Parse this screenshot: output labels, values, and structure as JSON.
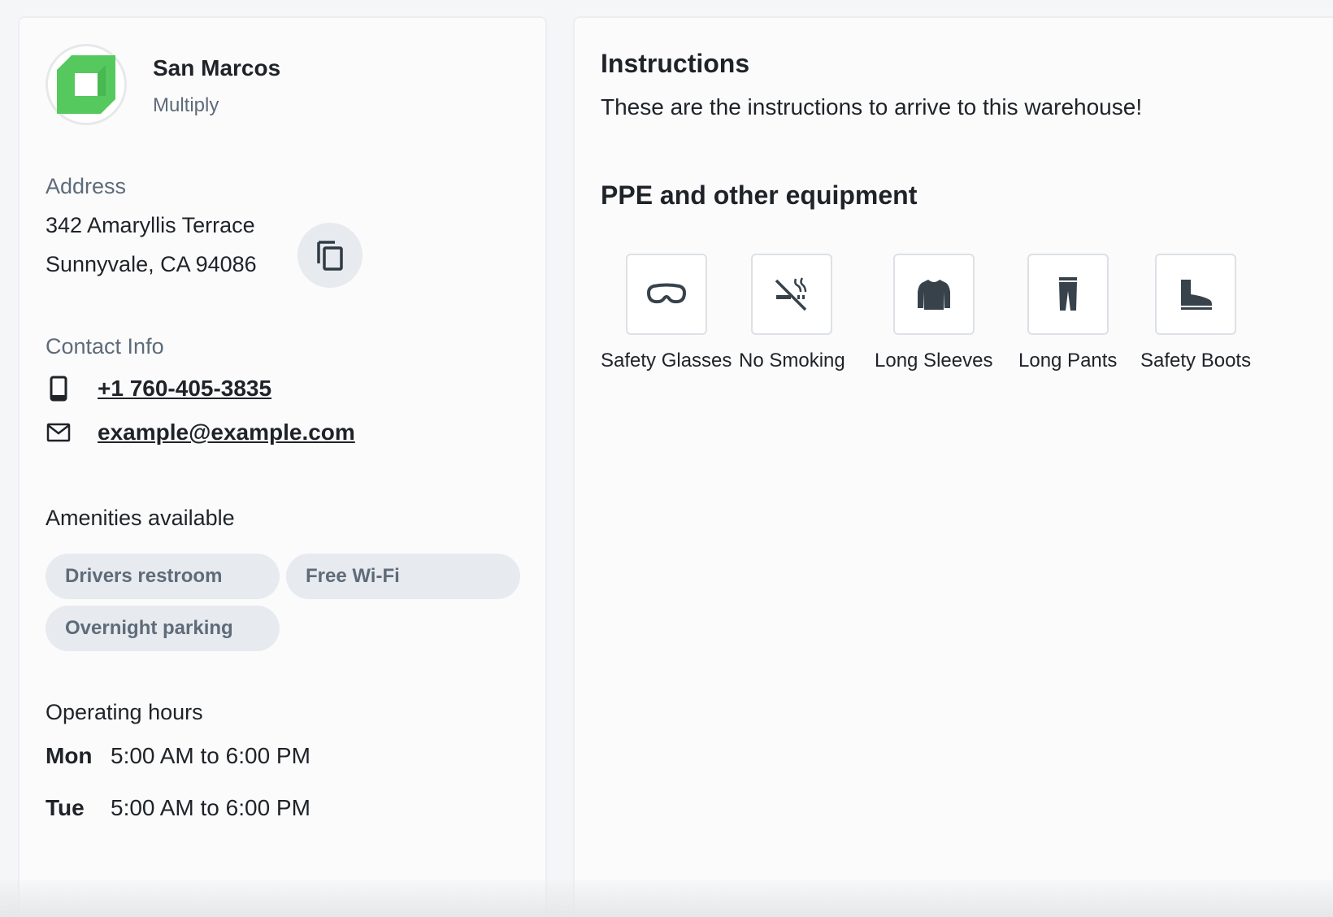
{
  "warehouse": {
    "name": "San Marcos",
    "company": "Multiply",
    "logo_color": "#55c95e"
  },
  "address": {
    "label": "Address",
    "line1": "342 Amaryllis Terrace",
    "line2": "Sunnyvale, CA 94086",
    "copy_icon": "copy-icon"
  },
  "contact": {
    "label": "Contact Info",
    "phone": "+1 760-405-3835",
    "email": "example@example.com"
  },
  "amenities": {
    "label": "Amenities available",
    "items": [
      "Drivers restroom",
      "Free Wi-Fi",
      "Overnight parking"
    ]
  },
  "hours": {
    "label": "Operating hours",
    "rows": [
      {
        "day": "Mon",
        "time": "5:00 AM to 6:00 PM"
      },
      {
        "day": "Tue",
        "time": "5:00 AM to 6:00 PM"
      }
    ]
  },
  "instructions": {
    "title": "Instructions",
    "text": "These are the instructions to arrive to this warehouse!"
  },
  "ppe": {
    "title": "PPE and other equipment",
    "items": [
      {
        "label": "Safety Glasses",
        "icon": "safety-glasses-icon"
      },
      {
        "label": "No Smoking",
        "icon": "no-smoking-icon"
      },
      {
        "label": "Long Sleeves",
        "icon": "long-sleeves-icon"
      },
      {
        "label": "Long Pants",
        "icon": "long-pants-icon"
      },
      {
        "label": "Safety Boots",
        "icon": "safety-boots-icon"
      }
    ]
  },
  "colors": {
    "primary_text": "#1f2328",
    "secondary_text": "#5e6b79",
    "chip_bg": "#e7eaee"
  }
}
